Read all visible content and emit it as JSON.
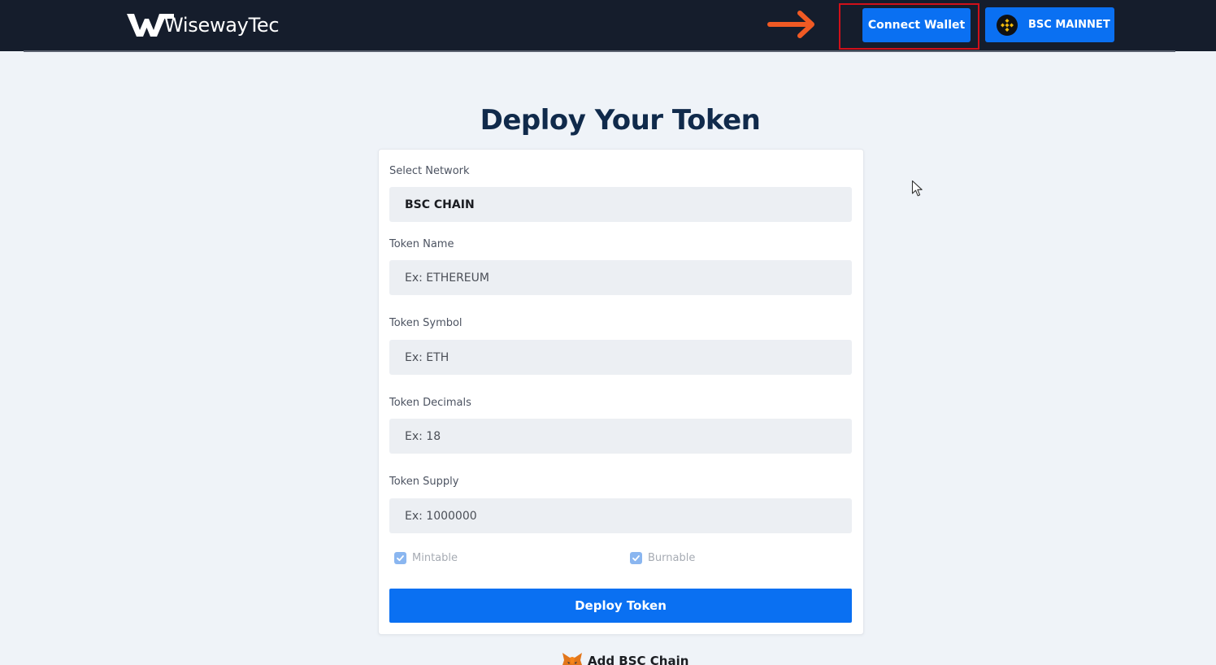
{
  "header": {
    "logo_text": "WisewayTec",
    "connect_label": "Connect Wallet",
    "network_label": "BSC MAINNET"
  },
  "main": {
    "title": "Deploy Your Token",
    "network": {
      "label": "Select Network",
      "value": "BSC CHAIN"
    },
    "token_name": {
      "label": "Token Name",
      "placeholder": "Ex: ETHEREUM"
    },
    "token_symbol": {
      "label": "Token Symbol",
      "placeholder": "Ex: ETH"
    },
    "token_decimals": {
      "label": "Token Decimals",
      "placeholder": "Ex: 18"
    },
    "token_supply": {
      "label": "Token Supply",
      "placeholder": "Ex: 1000000"
    },
    "mintable": {
      "label": "Mintable",
      "checked": true
    },
    "burnable": {
      "label": "Burnable",
      "checked": true
    },
    "deploy_label": "Deploy Token",
    "add_chain_label": "Add BSC Chain"
  },
  "icons": {
    "logo": "wiseway-logo-icon",
    "arrow": "arrow-right-icon",
    "network": "bnb-coin-icon",
    "add_chain": "metamask-fox-icon",
    "cursor": "mouse-pointer-icon"
  },
  "colors": {
    "topbar": "#151d2c",
    "accent": "#0a70f2",
    "title": "#102a4b",
    "highlight": "#d0101a",
    "arrow": "#f05a24",
    "bnb": "#f0b90b"
  }
}
